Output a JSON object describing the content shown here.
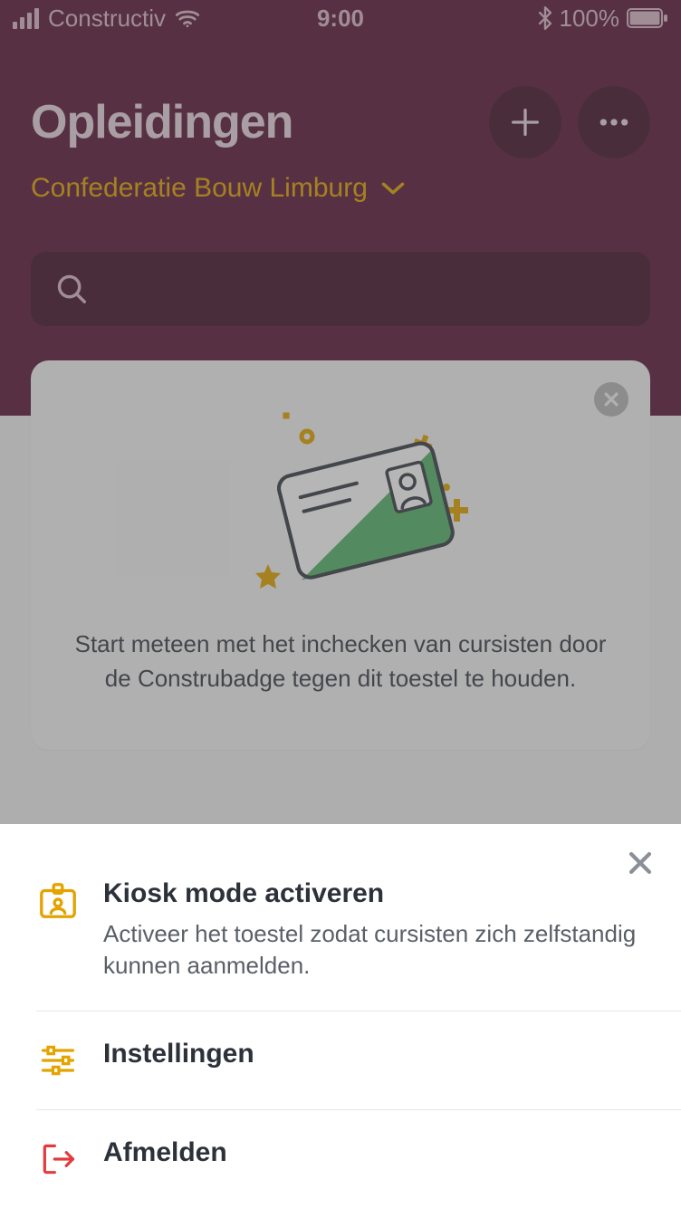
{
  "statusbar": {
    "carrier": "Constructiv",
    "time": "9:00",
    "battery": "100%"
  },
  "header": {
    "title": "Opleidingen",
    "subtitle": "Confederatie Bouw Limburg"
  },
  "info_card": {
    "text": "Start meteen met het inchecken van cursisten door de Construbadge tegen dit toestel te houden."
  },
  "sheet": {
    "items": [
      {
        "title": "Kiosk mode activeren",
        "desc": "Activeer het toestel zodat cursisten zich zelfstandig kunnen aanmelden."
      },
      {
        "title": "Instellingen"
      },
      {
        "title": "Afmelden"
      }
    ]
  }
}
